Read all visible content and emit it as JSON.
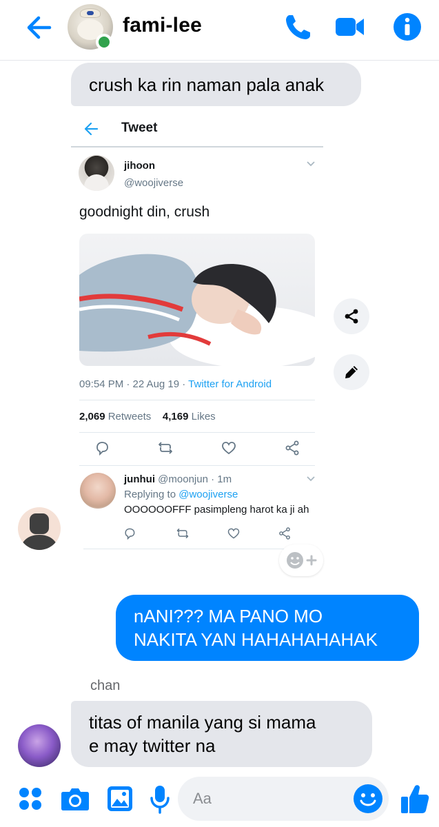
{
  "header": {
    "title": "fami-lee",
    "online": true
  },
  "messages": [
    {
      "id": "m1",
      "direction": "incoming",
      "text": "crush ka rin naman pala anak"
    },
    {
      "id": "m2",
      "direction": "outgoing",
      "line1": "nANI??? MA PANO MO",
      "line2": "NAKITA YAN HAHAHAHAHAK"
    },
    {
      "id": "m3",
      "direction": "incoming",
      "sender": "chan",
      "line1": "titas of manila yang si mama",
      "line2": "e may twitter na"
    }
  ],
  "tweet": {
    "screen_title": "Tweet",
    "author_name": "jihoon",
    "author_handle": "@woojiverse",
    "text": "goodnight din, crush",
    "time": "09:54 PM · 22 Aug 19 · ",
    "source": "Twitter for Android",
    "retweets_count": "2,069",
    "retweets_label": "Retweets",
    "likes_count": "4,169",
    "likes_label": "Likes",
    "reply": {
      "name": "junhui",
      "handle_time": "@moonjun · 1m",
      "replying_prefix": "Replying to ",
      "replying_to": "@woojiverse",
      "text": "OOOOOOFFF pasimpleng harot ka ji ah"
    }
  },
  "composer": {
    "placeholder": "Aa"
  },
  "colors": {
    "accent": "#0084ff",
    "incoming_bubble": "#e4e6eb",
    "twitter_blue": "#1da1f2",
    "online": "#31a24c"
  },
  "icons": {
    "header": [
      "back-arrow-icon",
      "phone-icon",
      "video-camera-icon",
      "info-icon"
    ],
    "side": [
      "share-icon",
      "pencil-icon"
    ],
    "composer": [
      "apps-icon",
      "camera-icon",
      "image-icon",
      "microphone-icon",
      "emoji-icon",
      "thumbs-up-icon"
    ]
  }
}
